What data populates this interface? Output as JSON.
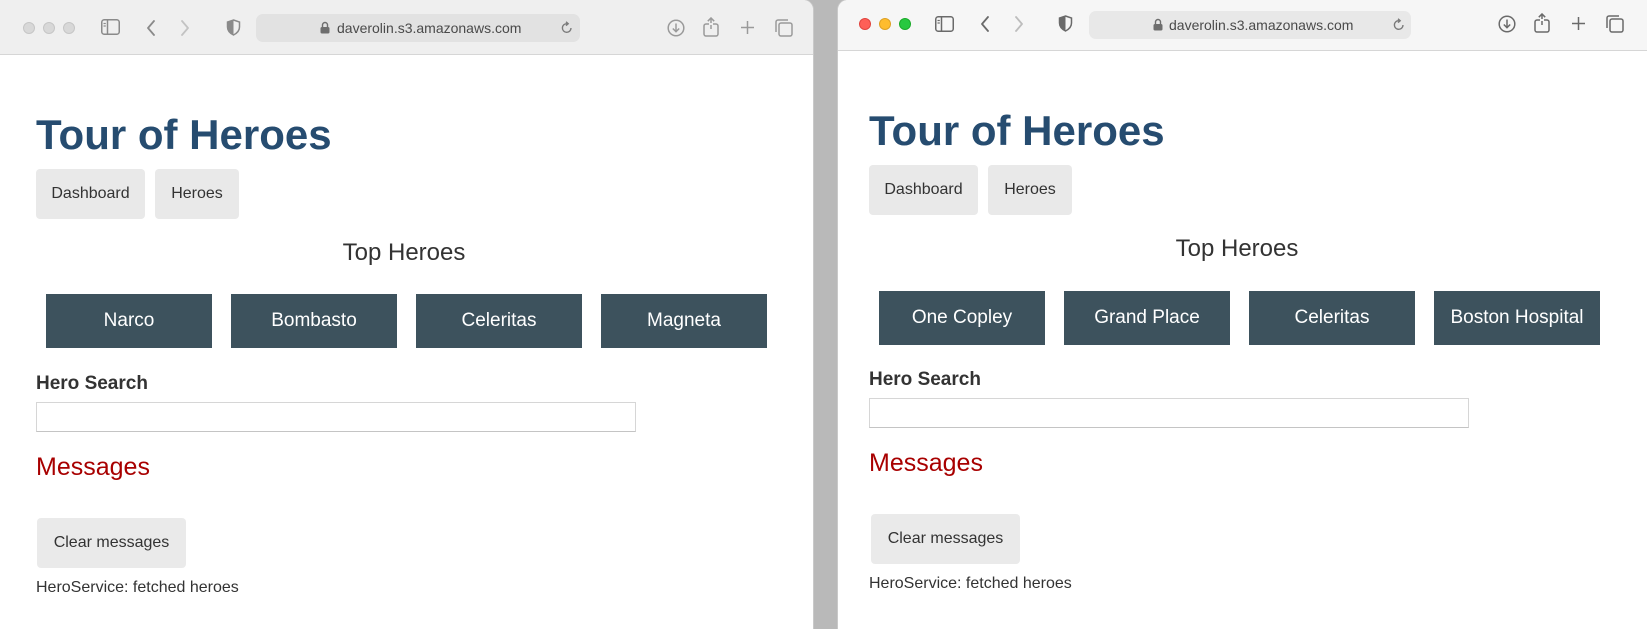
{
  "windows": [
    {
      "url": "daverolin.s3.amazonaws.com",
      "app_title": "Tour of Heroes",
      "nav": {
        "dashboard": "Dashboard",
        "heroes": "Heroes"
      },
      "top_heroes_heading": "Top Heroes",
      "heroes": [
        "Narco",
        "Bombasto",
        "Celeritas",
        "Magneta"
      ],
      "search": {
        "label": "Hero Search",
        "value": ""
      },
      "messages": {
        "heading": "Messages",
        "clear_label": "Clear messages",
        "items": [
          "HeroService: fetched heroes"
        ]
      }
    },
    {
      "url": "daverolin.s3.amazonaws.com",
      "app_title": "Tour of Heroes",
      "nav": {
        "dashboard": "Dashboard",
        "heroes": "Heroes"
      },
      "top_heroes_heading": "Top Heroes",
      "heroes": [
        "One Copley",
        "Grand Place",
        "Celeritas",
        "Boston Hospital"
      ],
      "search": {
        "label": "Hero Search",
        "value": ""
      },
      "messages": {
        "heading": "Messages",
        "clear_label": "Clear messages",
        "items": [
          "HeroService: fetched heroes"
        ]
      }
    }
  ],
  "colors": {
    "title": "#264c70",
    "hero_tile": "#3d525d",
    "messages_heading": "#a80000",
    "button_bg": "#e9e9e9"
  },
  "icons": {
    "sidebar": "sidebar-icon",
    "back": "chevron-left-icon",
    "forward": "chevron-right-icon",
    "privacy": "shield-icon",
    "lock": "lock-icon",
    "reload": "reload-icon",
    "download": "download-icon",
    "share": "share-icon",
    "new_tab": "plus-icon",
    "tabs": "tab-overview-icon"
  }
}
